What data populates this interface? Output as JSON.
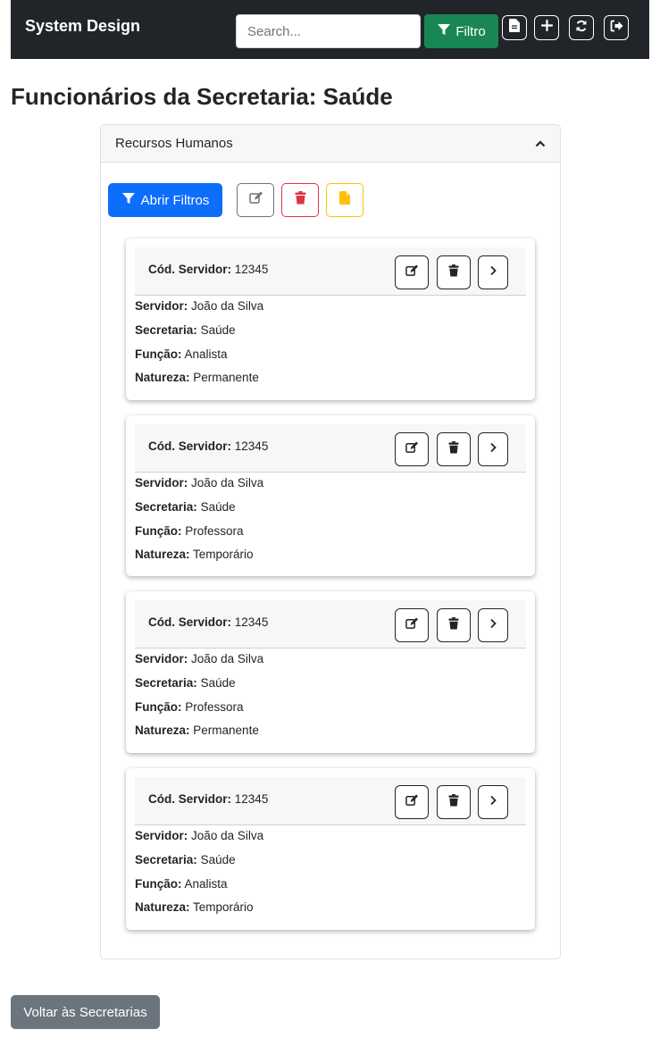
{
  "navbar": {
    "brand": "System Design",
    "search_placeholder": "Search...",
    "filter_label": "Filtro",
    "icons": [
      "file-icon",
      "plus-icon",
      "refresh-icon",
      "logout-icon"
    ]
  },
  "page": {
    "title": "Funcionários da Secretaria: Saúde"
  },
  "accordion": {
    "title": "Recursos Humanos",
    "open_filters_label": "Abrir Filtros"
  },
  "labels": {
    "code": "Cód. Servidor:",
    "servidor": "Servidor:",
    "secretaria": "Secretaria:",
    "funcao": "Função:",
    "natureza": "Natureza:"
  },
  "cards": [
    {
      "code": "12345",
      "servidor": "João da Silva",
      "secretaria": "Saúde",
      "funcao": "Analista",
      "natureza": "Permanente"
    },
    {
      "code": "12345",
      "servidor": "João da Silva",
      "secretaria": "Saúde",
      "funcao": "Professora",
      "natureza": "Temporário"
    },
    {
      "code": "12345",
      "servidor": "João da Silva",
      "secretaria": "Saúde",
      "funcao": "Professora",
      "natureza": "Permanente"
    },
    {
      "code": "12345",
      "servidor": "João da Silva",
      "secretaria": "Saúde",
      "funcao": "Analista",
      "natureza": "Temporário"
    }
  ],
  "footer": {
    "back_label": "Voltar às Secretarias"
  },
  "colors": {
    "navbar": "#212529",
    "success": "#198754",
    "primary": "#0d6efd",
    "danger": "#dc3545",
    "warning": "#ffc107",
    "secondary": "#6c757d"
  }
}
